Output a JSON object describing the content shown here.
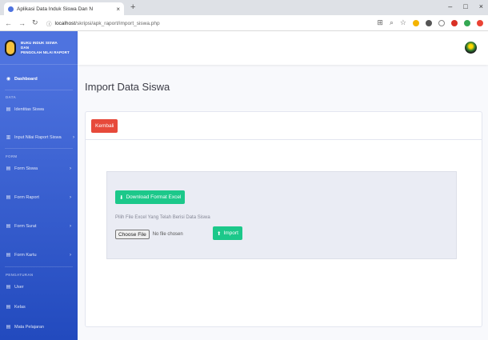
{
  "browser": {
    "tab_title": "Aplikasi Data Induk Siswa Dan N",
    "tab_close": "×",
    "new_tab": "+",
    "url_host": "localhost",
    "url_path": "/skripsi/apk_raport/import_siswa.php",
    "window_controls": [
      "–",
      "□",
      "×"
    ]
  },
  "sidebar": {
    "brand_lines": [
      "BUKU INDUK SISWA",
      "DAN",
      "PENGOLAH NILAI RAPORT"
    ],
    "dashboard": "Dashboard",
    "section_data": "DATA",
    "identitas": "Identitas Siswa",
    "input_nilai": "Input Nilai Raport Siswa",
    "section_form": "FORM",
    "form_siswa": "Form Siswa",
    "form_raport": "Form Raport",
    "form_surat": "Form Surat",
    "form_kartu": "Form Kartu",
    "section_pengaturan": "PENGATURAN",
    "user": "User",
    "kelas": "Kelas",
    "mapel": "Mata Pelajaran"
  },
  "main": {
    "page_title": "Import Data Siswa",
    "back_button": "Kembali",
    "download_button": "Download Format Excel",
    "help_text": "Pilih File Excel Yang Telah Berisi Data Siswa",
    "choose_file": "Choose File",
    "no_file": "No file chosen",
    "import_button": "Import"
  },
  "colors": {
    "sidebar": "#4e73df",
    "danger": "#e74a3b",
    "success": "#1cc88a"
  }
}
